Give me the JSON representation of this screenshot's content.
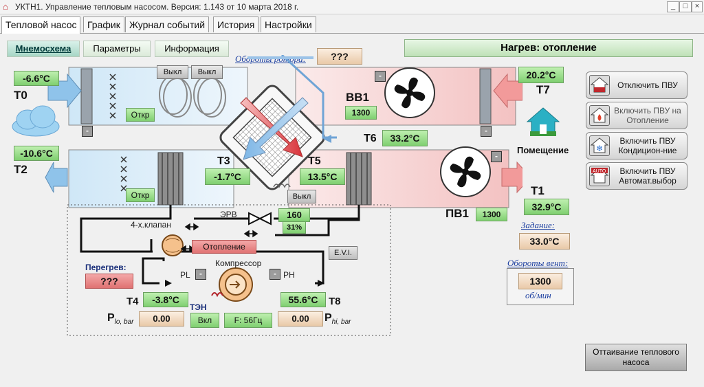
{
  "window": {
    "title": "УКТН1. Управление тепловым насосом. Версия: 1.143 от 10 марта 2018 г."
  },
  "tabs": [
    "Тепловой насос",
    "График",
    "Журнал событий",
    "История",
    "Настройки"
  ],
  "subtabs": [
    "Мнемосхема",
    "Параметры",
    "Информация"
  ],
  "rotor": {
    "label": "Обороты ротора:",
    "value": "???"
  },
  "mode": "Нагрев: отопление",
  "sensors": {
    "T0": {
      "label": "T0",
      "value": "-6.6°C"
    },
    "T2": {
      "label": "T2",
      "value": "-10.6°C"
    },
    "T3": {
      "label": "T3",
      "value": "-1.7°C"
    },
    "T5": {
      "label": "T5",
      "value": "13.5°C"
    },
    "T6": {
      "label": "T6",
      "value": "33.2°C"
    },
    "T7": {
      "label": "T7",
      "value": "20.2°C"
    },
    "T1": {
      "label": "T1",
      "value": "32.9°C"
    },
    "T4": {
      "label": "T4",
      "value": "-3.8°C"
    },
    "T8": {
      "label": "T8",
      "value": "55.6°C"
    }
  },
  "fans": {
    "vv1": {
      "label": "ВВ1",
      "value": "1300"
    },
    "pv1": {
      "label": "ПВ1",
      "value": "1300"
    }
  },
  "valves": {
    "open1": "Откр",
    "open2": "Откр",
    "off1": "Выкл",
    "off2": "Выкл",
    "off3": "Выкл"
  },
  "minus": "-",
  "room": "Помещение",
  "erv": {
    "label": "ЭРВ",
    "value": "160",
    "percent": "31%"
  },
  "valve4": {
    "label": "4-х.клапан",
    "mode": "Отопление"
  },
  "evi": "E.V.I.",
  "compressor": {
    "label": "Компрессор",
    "pl": "PL",
    "ph": "PH"
  },
  "overheat": {
    "label": "Перегрев:",
    "value": "???"
  },
  "ten": {
    "label": "ТЭН",
    "state": "Вкл",
    "freq": "F: 56Гц"
  },
  "pressure": {
    "lo": {
      "label": "P",
      "sub": "lo, bar",
      "value": "0.00"
    },
    "hi": {
      "label": "P",
      "sub": "hi, bar",
      "value": "0.00"
    }
  },
  "setpoint": {
    "label": "Задание:",
    "value": "33.0°C"
  },
  "fanspeed": {
    "label": "Обороты вент:",
    "value": "1300",
    "unit": "об/мин"
  },
  "actions": [
    {
      "label": "Отключить ПВУ",
      "icon": "stop-icon"
    },
    {
      "label": "Включить ПВУ на Отопление",
      "icon": "heating-icon"
    },
    {
      "label": "Включить ПВУ Кондицион-ние",
      "icon": "snowflake-icon"
    },
    {
      "label": "Включить ПВУ Автомат.выбор",
      "icon": "auto-icon"
    }
  ],
  "defrost": "Оттаивание теплового насоса",
  "colors": {
    "green": "#8fdc7d",
    "pink": "#e88080",
    "tan": "#f0d8bd",
    "blue_arrow": "#8fc3ea",
    "pink_arrow": "#f29a9a"
  }
}
